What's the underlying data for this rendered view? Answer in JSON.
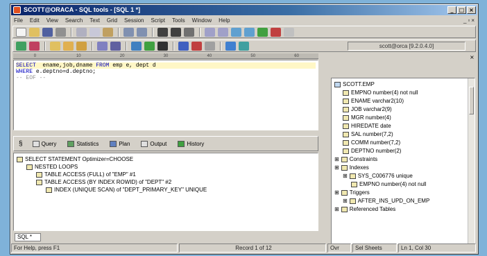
{
  "window": {
    "title": "SCOTT@ORACA - SQL tools - [SQL 1 *]"
  },
  "menu": [
    "File",
    "Edit",
    "View",
    "Search",
    "Text",
    "Grid",
    "Session",
    "Script",
    "Tools",
    "Window",
    "Help"
  ],
  "connection": "scott@orca [9.2.0.4.0]",
  "ruler_ticks": [
    "0",
    "10",
    "20",
    "30",
    "40",
    "50",
    "60"
  ],
  "editor": {
    "lines": [
      {
        "parts": [
          [
            "kw",
            "SELECT"
          ],
          [
            "",
            "  ename,job,dname "
          ],
          [
            "kw",
            "FROM"
          ],
          [
            "",
            " emp e, dept d"
          ]
        ]
      },
      {
        "parts": [
          [
            "kw",
            "WHERE"
          ],
          [
            "",
            " e.deptno=d.deptno;"
          ]
        ]
      },
      {
        "parts": [
          [
            "cm",
            "-- EOF --"
          ]
        ]
      }
    ]
  },
  "result_tabs": [
    "Query",
    "Statistics",
    "Plan",
    "Output",
    "History"
  ],
  "plan": [
    {
      "indent": 0,
      "text": "SELECT STATEMENT Optimizer=CHOOSE"
    },
    {
      "indent": 1,
      "text": "NESTED LOOPS"
    },
    {
      "indent": 2,
      "text": "TABLE ACCESS (FULL) of \"EMP\" #1"
    },
    {
      "indent": 2,
      "text": "TABLE ACCESS (BY INDEX ROWID) of \"DEPT\" #2"
    },
    {
      "indent": 3,
      "text": "INDEX (UNIQUE SCAN) of \"DEPT_PRIMARY_KEY\" UNIQUE"
    }
  ],
  "bottom_tab": "SQL *",
  "schema": [
    {
      "indent": 0,
      "text": "SCOTT.EMP",
      "db": true
    },
    {
      "indent": 1,
      "text": "EMPNO  number(4)  not null"
    },
    {
      "indent": 1,
      "text": "ENAME  varchar2(10)"
    },
    {
      "indent": 1,
      "text": "JOB  varchar2(9)"
    },
    {
      "indent": 1,
      "text": "MGR  number(4)"
    },
    {
      "indent": 1,
      "text": "HIREDATE  date"
    },
    {
      "indent": 1,
      "text": "SAL  number(7,2)"
    },
    {
      "indent": 1,
      "text": "COMM  number(7,2)"
    },
    {
      "indent": 1,
      "text": "DEPTNO  number(2)"
    },
    {
      "indent": 0,
      "text": "Constraints",
      "folder": true
    },
    {
      "indent": 0,
      "text": "Indexes",
      "folder": true
    },
    {
      "indent": 1,
      "text": "SYS_C006776  unique",
      "folder": true
    },
    {
      "indent": 2,
      "text": "EMPNO  number(4)  not null"
    },
    {
      "indent": 0,
      "text": "Triggers",
      "folder": true
    },
    {
      "indent": 1,
      "text": "AFTER_INS_UPD_ON_EMP",
      "folder": true
    },
    {
      "indent": 0,
      "text": "Referenced Tables",
      "folder": true
    }
  ],
  "status": {
    "help": "For Help, press F1",
    "record": "Record 1 of 12",
    "mode": "Ovr",
    "sheet": "Sel Sheets",
    "pos": "Ln 1, Col 30"
  },
  "colors": {
    "title": "#0a246a",
    "keyword": "#0000c0",
    "editor_hl": "#fff7c6"
  }
}
